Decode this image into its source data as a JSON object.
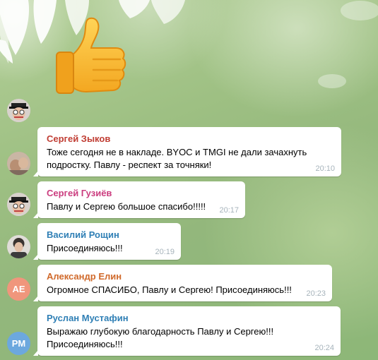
{
  "colors": {
    "name_red": "#c03d33",
    "name_pink": "#cb3d7f",
    "name_blue": "#2f7fb5",
    "name_orange": "#d0692a",
    "avatar_ae": "#f0967c",
    "avatar_pm": "#6ca8de",
    "time": "#a6b3bb"
  },
  "sticker": {
    "icon": "thumbs-up-icon"
  },
  "messages": [
    {
      "author": "Сергей Зыков",
      "line1": "Тоже  сегодня не в накладе. BYOC и TMGI не дали зачахнуть",
      "line2": "подростку. Павлу - респект за точняки!",
      "time": "20:10"
    },
    {
      "author": "Сергей Гузиёв",
      "line1": "Павлу и Сергею большое спасибо!!!!!",
      "time": "20:17"
    },
    {
      "author": "Василий Рощин",
      "line1": "Присоединяюсь!!!",
      "time": "20:19"
    },
    {
      "author": "Александр Елин",
      "avatar": "AE",
      "line1": "Огромное СПАСИБО, Павлу и Сергею! Присоединяюсь!!!",
      "time": "20:23"
    },
    {
      "author": "Руслан Мустафин",
      "avatar": "PM",
      "line1": "Выражаю глубокую благодарность Павлу и Сергею!!!",
      "line2": "Присоединяюсь!!!",
      "time": "20:24"
    }
  ]
}
